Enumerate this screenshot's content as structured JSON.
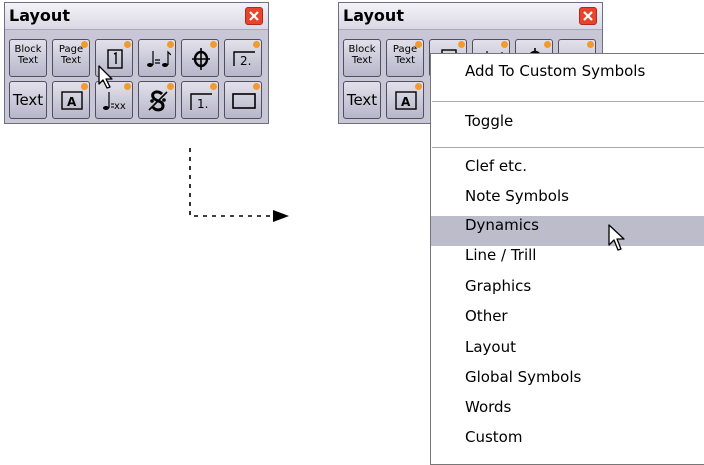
{
  "panel": {
    "title": "Layout",
    "buttons": {
      "block_text": "Block\nText",
      "page_text": "Page\nText",
      "text": "Text"
    }
  },
  "context_menu": {
    "items": [
      "Add To Custom Symbols",
      "Toggle",
      "Clef etc.",
      "Note Symbols",
      "Dynamics",
      "Line / Trill",
      "Graphics",
      "Other",
      "Layout",
      "Global Symbols",
      "Words",
      "Custom"
    ],
    "highlighted": "Dynamics"
  },
  "colors": {
    "badge": "#f19a2d",
    "close": "#e8442d",
    "highlight": "#bdbccb"
  }
}
